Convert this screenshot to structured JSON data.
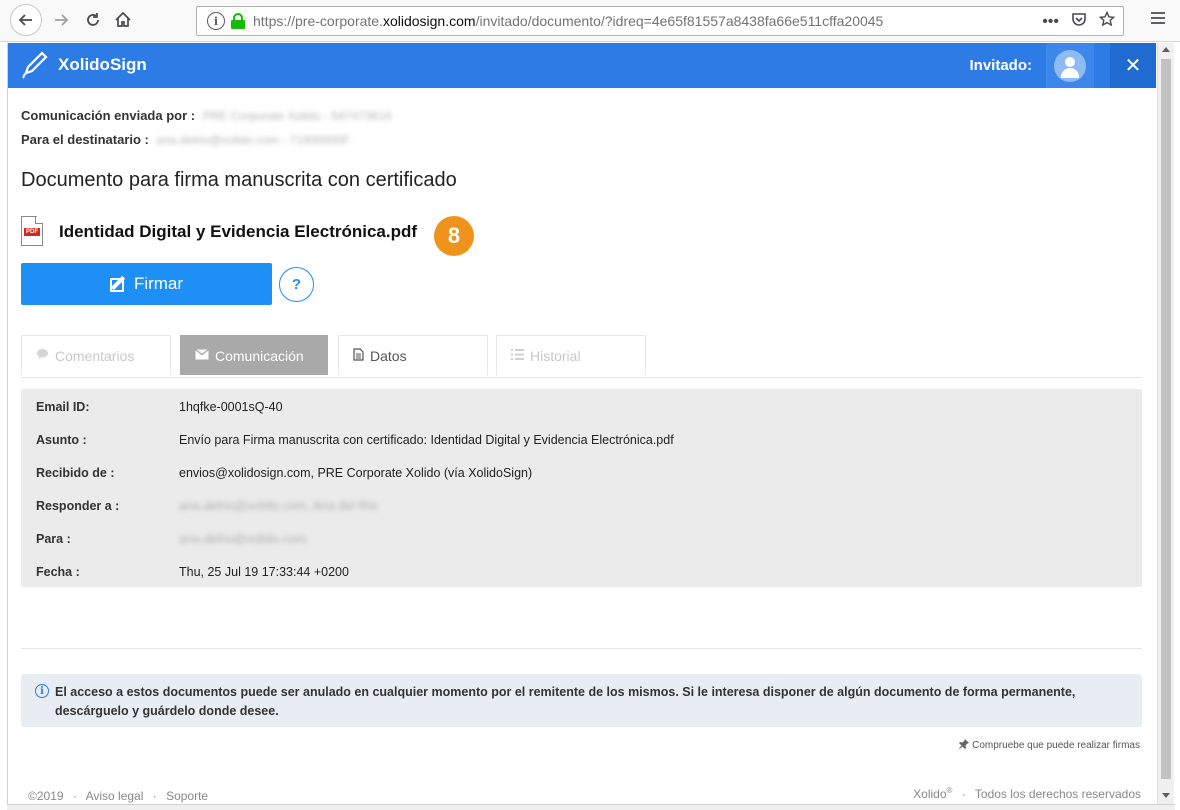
{
  "browser": {
    "url_prefix": "https://pre-corporate.",
    "url_domain": "xolidosign.com",
    "url_suffix": "/invitado/documento/?idreq=4e65f81557a8438fa66e511cffa20045",
    "actions": {
      "more": "•••"
    }
  },
  "header": {
    "app_name": "XolidoSign",
    "role_label": "Invitado:",
    "close_label": "✕"
  },
  "meta": {
    "sent_by_label": "Comunicación enviada por :",
    "sent_by_value": "PRE Corporate Xolido - 647473616",
    "recipient_label": "Para el destinatario :",
    "recipient_value": "ana.delrio@xolido.com - 71900000F"
  },
  "document": {
    "title": "Documento para firma manuscrita con certificado",
    "file_name": "Identidad Digital y Evidencia Electrónica.pdf",
    "file_icon_tag": "PDF",
    "step_badge": "8"
  },
  "actions": {
    "sign_label": "Firmar",
    "help_label": "?"
  },
  "tabs": [
    {
      "label": "Comentarios",
      "icon": "comment-icon",
      "active": false,
      "enabled": false
    },
    {
      "label": "Comunicación",
      "icon": "envelope-icon",
      "active": true,
      "enabled": true
    },
    {
      "label": "Datos",
      "icon": "document-icon",
      "active": false,
      "enabled": true
    },
    {
      "label": "Historial",
      "icon": "list-icon",
      "active": false,
      "enabled": false
    }
  ],
  "communication": {
    "rows": [
      {
        "label": "Email ID:",
        "value": "1hqfke-0001sQ-40",
        "blurred": false
      },
      {
        "label": "Asunto :",
        "value": "Envío para Firma manuscrita con certificado: Identidad Digital y Evidencia Electrónica.pdf",
        "blurred": false
      },
      {
        "label": "Recibido de :",
        "value": "envios@xolidosign.com, PRE Corporate Xolido (vía XolidoSign)",
        "blurred": false
      },
      {
        "label": "Responder a :",
        "value": "ana.delrio@xolido.com, Ana del Río",
        "blurred": true
      },
      {
        "label": "Para :",
        "value": "ana.delrio@xolido.com",
        "blurred": true
      },
      {
        "label": "Fecha :",
        "value": "Thu, 25 Jul 19 17:33:44 +0200",
        "blurred": false
      }
    ]
  },
  "notice": {
    "text": "El acceso a estos documentos puede ser anulado en cualquier momento por el remitente de los mismos. Si le interesa disponer de algún documento de forma permanente, descárguelo y guárdelo donde desee."
  },
  "check_link": "Compruebe que puede realizar firmas",
  "footer": {
    "copyright": "©2019",
    "legal": "Aviso legal",
    "support": "Soporte",
    "brand": "Xolido",
    "brand_mark": "®",
    "rights": "Todos los derechos reservados",
    "separator": "·"
  },
  "colors": {
    "header_blue": "#2d7be5",
    "sign_button": "#1e90f5",
    "badge_orange": "#f0931c",
    "active_tab": "#a9a9a9"
  }
}
